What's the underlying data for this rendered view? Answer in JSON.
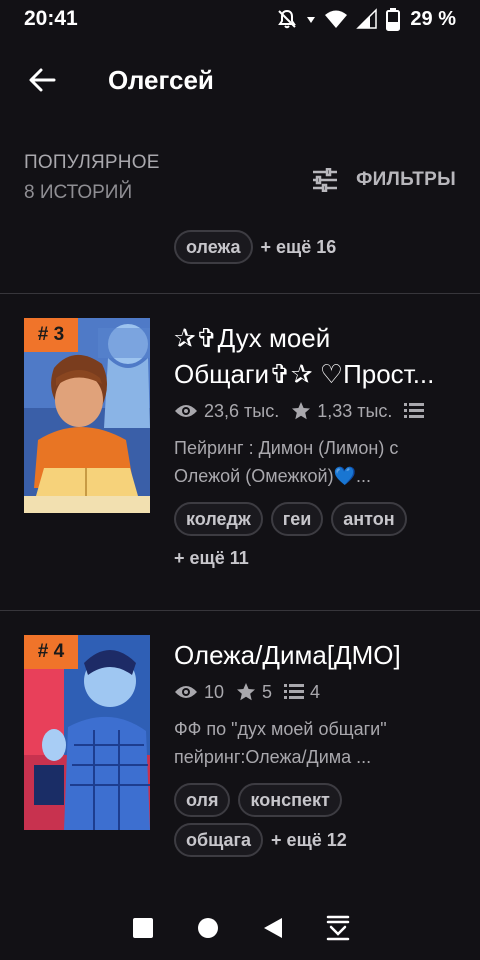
{
  "status": {
    "time": "20:41",
    "battery": "29 %"
  },
  "app_bar": {
    "title": "Олегсей"
  },
  "section": {
    "title": "ПОПУЛЯРНОЕ",
    "count": "8 ИСТОРИЙ",
    "filters_label": "ФИЛЬТРЫ"
  },
  "partial": {
    "tag": "олежа",
    "more": "+ ещё 16"
  },
  "stories": [
    {
      "rank": "# 3",
      "title_line1": "✰✞Дух моей",
      "title_line2": "Общаги✞✰  ♡Прост...",
      "reads": "23,6 тыс.",
      "votes": "1,33 тыс.",
      "parts": "",
      "desc_line1": "Пейринг : Димон (Лимон) с",
      "desc_line2": "Олежой (Омежкой)💙...",
      "tags": [
        "коледж",
        "геи",
        "антон"
      ],
      "more": "+ ещё 11"
    },
    {
      "rank": "# 4",
      "title_line1": "Олежа/Дима[ДМО]",
      "reads": "10",
      "votes": "5",
      "parts": "4",
      "desc_line1": "ФФ по \"дух моей общаги\"",
      "desc_line2": "пейринг:Олежа/Дима ...",
      "tags": [
        "оля",
        "конспект",
        "общага"
      ],
      "more": "+ ещё 12"
    }
  ],
  "colors": {
    "background": "#121115",
    "rank_badge": "#f0742a",
    "tag_border": "#3d3c42",
    "divider": "#37363b"
  }
}
